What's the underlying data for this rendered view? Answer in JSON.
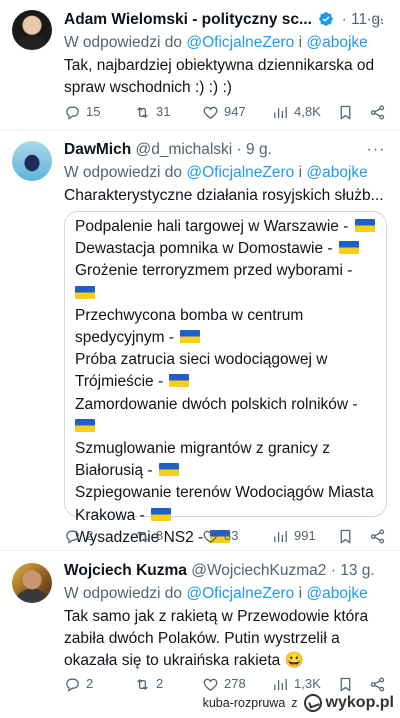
{
  "tweets": [
    {
      "name": "Adam Wielomski - polityczny sc...",
      "handle": "",
      "time": "11 g.",
      "reply_prefix": "W odpowiedzi do",
      "reply_to_1": "@OficjalneZero",
      "reply_and": "i",
      "reply_to_2": "@abojke",
      "text_lines": [
        "Tak, najbardziej obiektywna dziennikarska od",
        "spraw wschodnich :) :) :)"
      ],
      "replies": "15",
      "retweets": "31",
      "likes": "947",
      "views": "4,8K"
    },
    {
      "name": "DawMich",
      "handle": "@d_michalski",
      "time": "9 g.",
      "reply_prefix": "W odpowiedzi do",
      "reply_to_1": "@OficjalneZero",
      "reply_and": "i",
      "reply_to_2": "@abojke",
      "text_lines": [
        "Charakterystyczne działania rosyjskich służb..."
      ],
      "quote_lines": [
        "Podpalenie hali targowej w Warszawie -",
        "Dewastacja pomnika w Domostawie -",
        "Grożenie terroryzmem przed wyborami -",
        "",
        "Przechwycona bomba w centrum",
        "spedycyjnym -",
        "Próba zatrucia sieci wodociągowej w",
        "Trójmieście -",
        "Zamordowanie dwóch polskich rolników -",
        "",
        "Szmuglowanie migrantów z granicy z",
        "Białorusią -",
        "Szpiegowanie terenów Wodociągów Miasta",
        "Krakowa -",
        "Wysadzenie NS2 -"
      ],
      "replies": "2",
      "retweets": "8",
      "likes": "83",
      "views": "991"
    },
    {
      "name": "Wojciech Kuzma",
      "handle": "@WojciechKuzma2",
      "time": "13 g.",
      "reply_prefix": "W odpowiedzi do",
      "reply_to_1": "@OficjalneZero",
      "reply_and": "i",
      "reply_to_2": "@abojke",
      "text_lines": [
        "Tak samo jak z rakietą w Przewodowie która",
        "zabiła dwóch Polaków.  Putin wystrzelił a",
        "okazała się to ukraińska rakieta 😀"
      ],
      "replies": "2",
      "retweets": "2",
      "likes": "278",
      "views": "1,3K"
    }
  ],
  "watermark": {
    "user": "kuba-rozpruwa",
    "suffix": "z",
    "site": "wykop.pl"
  },
  "colors": {
    "link": "#1d9bf0",
    "muted": "#536471",
    "text": "#0f1419",
    "flag_blue": "#1f5fc9",
    "flag_yellow": "#f6cf16"
  }
}
